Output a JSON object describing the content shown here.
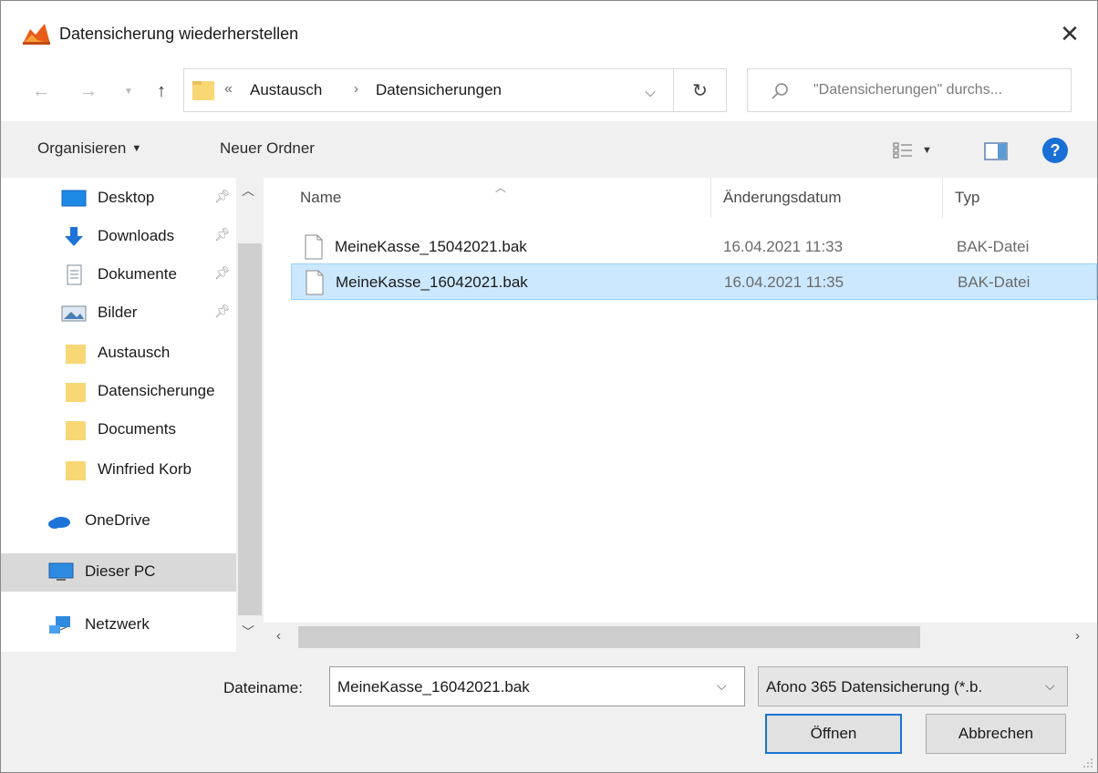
{
  "window": {
    "title": "Datensicherung wiederherstellen",
    "close_label": "✕"
  },
  "address": {
    "chevrons": "«",
    "breadcrumb": [
      "Austausch",
      "Datensicherungen"
    ],
    "separator": "›"
  },
  "search": {
    "placeholder": "\"Datensicherungen\" durchs..."
  },
  "toolbar": {
    "organize_label": "Organisieren",
    "new_folder_label": "Neuer Ordner",
    "help_label": "?"
  },
  "sidebar": {
    "items": [
      {
        "label": "Desktop",
        "icon": "desktop-icon",
        "pinned": true
      },
      {
        "label": "Downloads",
        "icon": "download-arrow-icon",
        "pinned": true
      },
      {
        "label": "Dokumente",
        "icon": "document-icon",
        "pinned": true
      },
      {
        "label": "Bilder",
        "icon": "pictures-icon",
        "pinned": true
      },
      {
        "label": "Austausch",
        "icon": "folder-icon",
        "pinned": false
      },
      {
        "label": "Datensicherunge",
        "icon": "folder-icon",
        "pinned": false
      },
      {
        "label": "Documents",
        "icon": "folder-icon",
        "pinned": false
      },
      {
        "label": "Winfried Korb",
        "icon": "folder-icon",
        "pinned": false
      },
      {
        "label": "OneDrive",
        "icon": "cloud-icon",
        "pinned": false
      },
      {
        "label": "Dieser PC",
        "icon": "computer-icon",
        "pinned": false,
        "selected": true
      },
      {
        "label": "Netzwerk",
        "icon": "network-icon",
        "pinned": false
      }
    ]
  },
  "files": {
    "columns": [
      "Name",
      "Änderungsdatum",
      "Typ"
    ],
    "rows": [
      {
        "name": "MeineKasse_15042021.bak",
        "date": "16.04.2021 11:33",
        "type": "BAK-Datei",
        "selected": false
      },
      {
        "name": "MeineKasse_16042021.bak",
        "date": "16.04.2021 11:35",
        "type": "BAK-Datei",
        "selected": true
      }
    ]
  },
  "footer": {
    "filename_label": "Dateiname:",
    "filename_value": "MeineKasse_16042021.bak",
    "filter_value": "Afono 365 Datensicherung (*.b.",
    "open_label": "Öffnen",
    "cancel_label": "Abbrechen"
  },
  "colors": {
    "selection_bg": "#cce8ff",
    "selection_border": "#99d1ff",
    "accent": "#1a73d4",
    "folder": "#f8d775"
  }
}
